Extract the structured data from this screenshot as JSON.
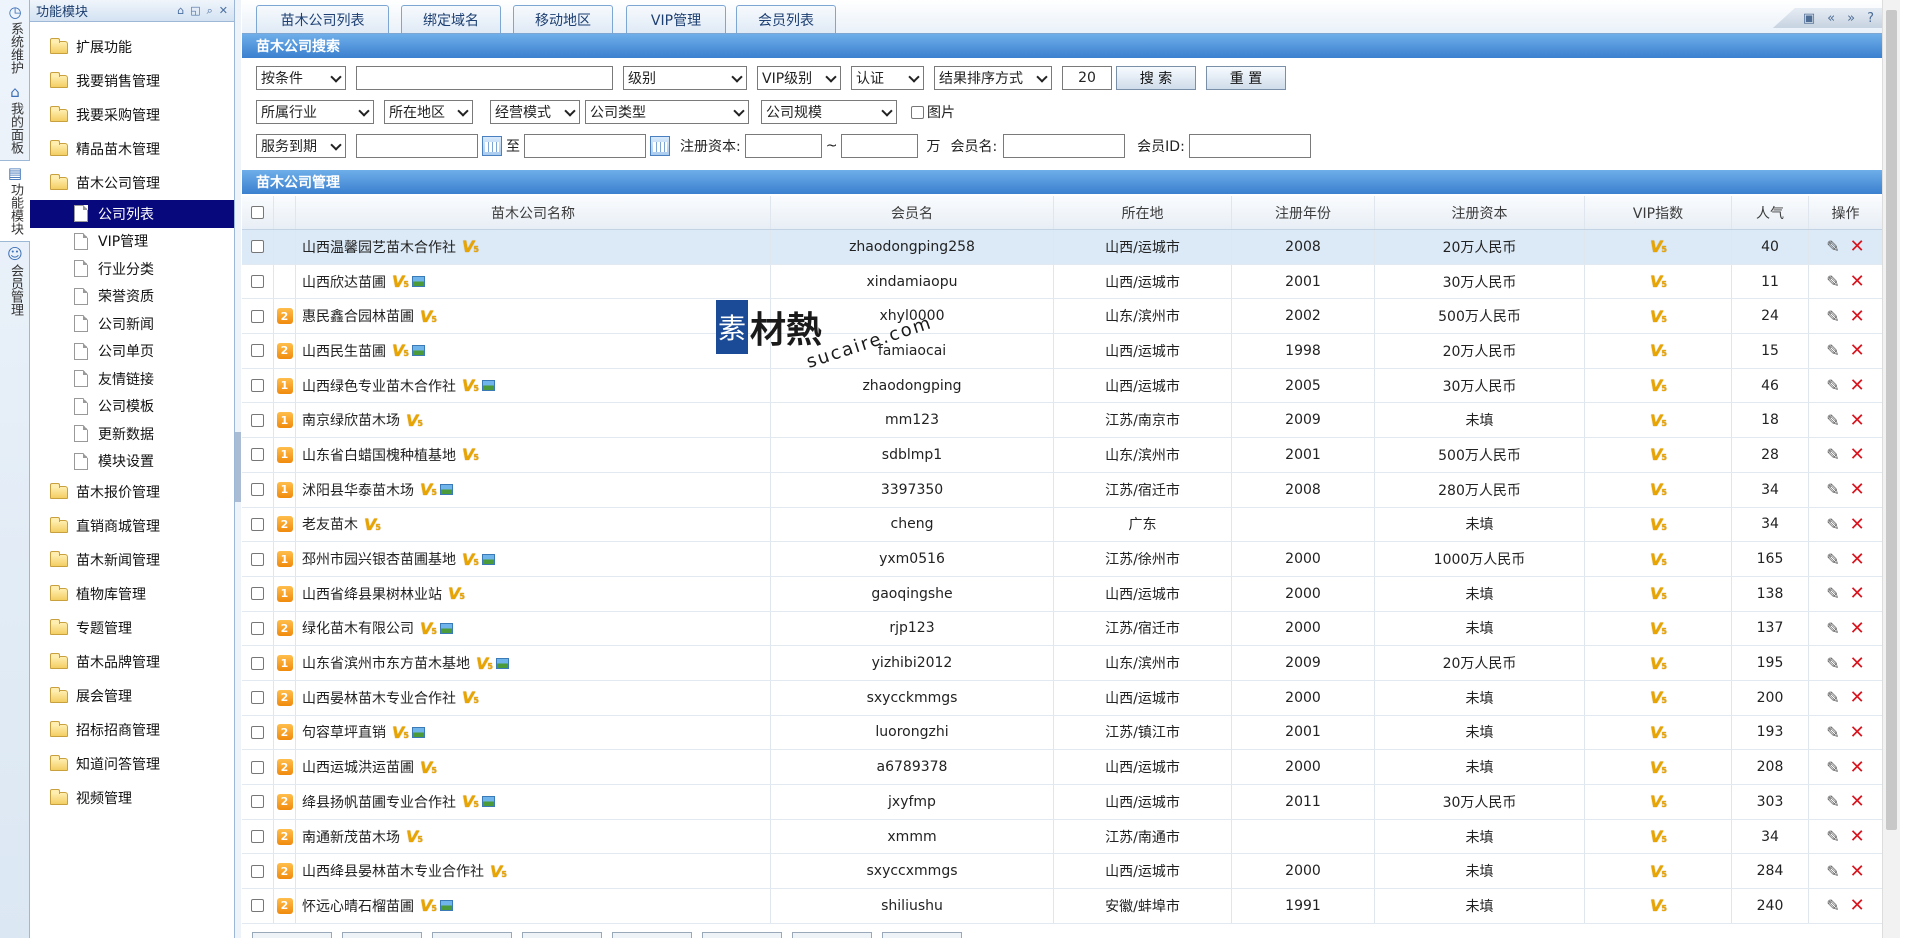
{
  "vertical_tabs": [
    {
      "label": "系统维护",
      "icon": "clock-icon"
    },
    {
      "label": "我的面板",
      "icon": "home-icon"
    },
    {
      "label": "功能模块",
      "icon": "module-icon"
    },
    {
      "label": "会员管理",
      "icon": "user-icon"
    }
  ],
  "left_panel": {
    "title": "功能模块",
    "items": [
      {
        "label": "扩展功能",
        "type": "folder"
      },
      {
        "label": "我要销售管理",
        "type": "folder"
      },
      {
        "label": "我要采购管理",
        "type": "folder"
      },
      {
        "label": "精品苗木管理",
        "type": "folder"
      },
      {
        "label": "苗木公司管理",
        "type": "folder"
      },
      {
        "label": "公司列表",
        "type": "doc",
        "selected": true
      },
      {
        "label": "VIP管理",
        "type": "doc"
      },
      {
        "label": "行业分类",
        "type": "doc"
      },
      {
        "label": "荣誉资质",
        "type": "doc"
      },
      {
        "label": "公司新闻",
        "type": "doc"
      },
      {
        "label": "公司单页",
        "type": "doc"
      },
      {
        "label": "友情链接",
        "type": "doc"
      },
      {
        "label": "公司模板",
        "type": "doc"
      },
      {
        "label": "更新数据",
        "type": "doc"
      },
      {
        "label": "模块设置",
        "type": "doc"
      },
      {
        "label": "苗木报价管理",
        "type": "folder"
      },
      {
        "label": "直销商城管理",
        "type": "folder"
      },
      {
        "label": "苗木新闻管理",
        "type": "folder"
      },
      {
        "label": "植物库管理",
        "type": "folder"
      },
      {
        "label": "专题管理",
        "type": "folder"
      },
      {
        "label": "苗木品牌管理",
        "type": "folder"
      },
      {
        "label": "展会管理",
        "type": "folder"
      },
      {
        "label": "招标招商管理",
        "type": "folder"
      },
      {
        "label": "知道问答管理",
        "type": "folder"
      },
      {
        "label": "视频管理",
        "type": "folder"
      }
    ]
  },
  "tabs": [
    {
      "label": "苗木公司列表",
      "active": true
    },
    {
      "label": "绑定域名"
    },
    {
      "label": "移动地区"
    },
    {
      "label": "VIP管理"
    },
    {
      "label": "会员列表"
    }
  ],
  "search": {
    "title": "苗木公司搜索",
    "row1": {
      "condition": "按条件",
      "keyword": "",
      "level": "级别",
      "vip_level": "VIP级别",
      "certify": "认证",
      "sort": "结果排序方式",
      "page_size": "20",
      "search_label": "搜 索",
      "reset_label": "重 置"
    },
    "row2": {
      "industry": "所属行业",
      "region": "所在地区",
      "mode": "经营模式",
      "company_type": "公司类型",
      "company_size": "公司规模",
      "image_label": "图片"
    },
    "row3": {
      "service_due": "服务到期",
      "to_label": "至",
      "capital_label": "注册资本:",
      "tilde": "~",
      "wan_label": "万",
      "member_name_label": "会员名:",
      "member_id_label": "会员ID:"
    }
  },
  "manage": {
    "title": "苗木公司管理",
    "columns": [
      "苗木公司名称",
      "会员名",
      "所在地",
      "注册年份",
      "注册资本",
      "VIP指数",
      "人气",
      "操作"
    ],
    "rows": [
      {
        "rank": "",
        "name": "山西温馨园艺苗木合作社",
        "pic": false,
        "member": "zhaodongping258",
        "location": "山西/运城市",
        "year": "2008",
        "capital": "20万人民币",
        "views": "40",
        "highlight": true
      },
      {
        "rank": "",
        "name": "山西欣达苗圃",
        "pic": true,
        "member": "xindamiaopu",
        "location": "山西/运城市",
        "year": "2001",
        "capital": "30万人民币",
        "views": "11"
      },
      {
        "rank": "2",
        "name": "惠民鑫合园林苗圃",
        "pic": false,
        "member": "xhyl0000",
        "location": "山东/滨州市",
        "year": "2002",
        "capital": "500万人民币",
        "views": "24"
      },
      {
        "rank": "2",
        "name": "山西民生苗圃",
        "pic": true,
        "member": "famiaocai",
        "location": "山西/运城市",
        "year": "1998",
        "capital": "20万人民币",
        "views": "15"
      },
      {
        "rank": "1",
        "name": "山西绿色专业苗木合作社",
        "pic": true,
        "member": "zhaodongping",
        "location": "山西/运城市",
        "year": "2005",
        "capital": "30万人民币",
        "views": "46"
      },
      {
        "rank": "1",
        "name": "南京绿欣苗木场",
        "pic": false,
        "member": "mm123",
        "location": "江苏/南京市",
        "year": "2009",
        "capital": "未填",
        "views": "18"
      },
      {
        "rank": "1",
        "name": "山东省白蜡国槐种植基地",
        "pic": false,
        "member": "sdblmp1",
        "location": "山东/滨州市",
        "year": "2001",
        "capital": "500万人民币",
        "views": "28"
      },
      {
        "rank": "1",
        "name": "沭阳县华泰苗木场",
        "pic": true,
        "member": "3397350",
        "location": "江苏/宿迁市",
        "year": "2008",
        "capital": "280万人民币",
        "views": "34"
      },
      {
        "rank": "2",
        "name": "老友苗木",
        "pic": false,
        "member": "cheng",
        "location": "广东",
        "year": "",
        "capital": "未填",
        "views": "34"
      },
      {
        "rank": "1",
        "name": "邳州市园兴银杏苗圃基地",
        "pic": true,
        "member": "yxm0516",
        "location": "江苏/徐州市",
        "year": "2000",
        "capital": "1000万人民币",
        "views": "165"
      },
      {
        "rank": "1",
        "name": "山西省绛县果树林业站",
        "pic": false,
        "member": "gaoqingshe",
        "location": "山西/运城市",
        "year": "2000",
        "capital": "未填",
        "views": "138"
      },
      {
        "rank": "2",
        "name": "绿化苗木有限公司",
        "pic": true,
        "member": "rjp123",
        "location": "江苏/宿迁市",
        "year": "2000",
        "capital": "未填",
        "views": "137"
      },
      {
        "rank": "1",
        "name": "山东省滨州市东方苗木基地",
        "pic": true,
        "member": "yizhibi2012",
        "location": "山东/滨州市",
        "year": "2009",
        "capital": "20万人民币",
        "views": "195"
      },
      {
        "rank": "2",
        "name": "山西晏林苗木专业合作社",
        "pic": false,
        "member": "sxycckmmgs",
        "location": "山西/运城市",
        "year": "2000",
        "capital": "未填",
        "views": "200"
      },
      {
        "rank": "2",
        "name": "句容草坪直销",
        "pic": true,
        "member": "luorongzhi",
        "location": "江苏/镇江市",
        "year": "2001",
        "capital": "未填",
        "views": "193"
      },
      {
        "rank": "2",
        "name": "山西运城洪运苗圃",
        "pic": false,
        "member": "a6789378",
        "location": "山西/运城市",
        "year": "2000",
        "capital": "未填",
        "views": "208"
      },
      {
        "rank": "2",
        "name": "绛县扬帆苗圃专业合作社",
        "pic": true,
        "member": "jxyfmp",
        "location": "山西/运城市",
        "year": "2011",
        "capital": "30万人民币",
        "views": "303"
      },
      {
        "rank": "2",
        "name": "南通新茂苗木场",
        "pic": false,
        "member": "xmmm",
        "location": "江苏/南通市",
        "year": "",
        "capital": "未填",
        "views": "34"
      },
      {
        "rank": "2",
        "name": "山西绛县晏林苗木专业合作社",
        "pic": false,
        "member": "sxyccxmmgs",
        "location": "山西/运城市",
        "year": "2000",
        "capital": "未填",
        "views": "284"
      },
      {
        "rank": "2",
        "name": "怀远心晴石榴苗圃",
        "pic": true,
        "member": "shiliushu",
        "location": "安徽/蚌埠市",
        "year": "1991",
        "capital": "未填",
        "views": "240"
      }
    ]
  },
  "watermark": {
    "brand": "素材熱",
    "box_char": "素",
    "text": "材熱",
    "url": "sucaire.com"
  },
  "colors": {
    "accent": "#3b80cf",
    "selected": "#08087d",
    "vip": "#e8a400",
    "delete": "#d8141e"
  }
}
